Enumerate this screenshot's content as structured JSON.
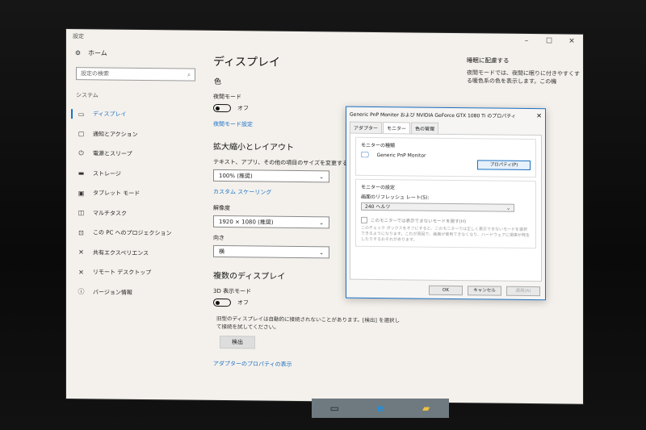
{
  "window": {
    "title": "設定"
  },
  "sidebar": {
    "home": "ホーム",
    "search_placeholder": "設定の検索",
    "section": "システム",
    "items": [
      {
        "label": "ディスプレイ",
        "icon": "monitor-icon",
        "active": true
      },
      {
        "label": "通知とアクション",
        "icon": "notification-icon"
      },
      {
        "label": "電源とスリープ",
        "icon": "power-icon"
      },
      {
        "label": "ストレージ",
        "icon": "storage-icon"
      },
      {
        "label": "タブレット モード",
        "icon": "tablet-icon"
      },
      {
        "label": "マルチタスク",
        "icon": "multitask-icon"
      },
      {
        "label": "この PC へのプロジェクション",
        "icon": "projection-icon"
      },
      {
        "label": "共有エクスペリエンス",
        "icon": "share-icon"
      },
      {
        "label": "リモート デスクトップ",
        "icon": "remote-icon"
      },
      {
        "label": "バージョン情報",
        "icon": "info-icon"
      }
    ]
  },
  "main": {
    "title": "ディスプレイ",
    "color_heading": "色",
    "night_mode_label": "夜間モード",
    "night_mode_state": "オフ",
    "night_mode_link": "夜間モード設定",
    "scale_heading": "拡大縮小とレイアウト",
    "scale_label": "テキスト、アプリ、その他の項目のサイズを変更する",
    "scale_value": "100% (推奨)",
    "custom_scaling_link": "カスタム スケーリング",
    "resolution_label": "解像度",
    "resolution_value": "1920 × 1080 (推奨)",
    "orientation_label": "向き",
    "orientation_value": "横",
    "multi_heading": "複数のディスプレイ",
    "3d_label": "3D 表示モード",
    "3d_state": "オフ",
    "detect_desc": "旧型のディスプレイは自動的に接続されないことがあります。[検出] を選択して接続を試してください。",
    "detect_button": "検出",
    "adapter_link": "アダプターのプロパティの表示"
  },
  "right": {
    "title": "睡眠に配慮する",
    "desc": "夜間モードでは、夜間に眠りに付きやすくする暖色系の色を表示します。この機"
  },
  "dialog": {
    "title": "Generic PnP Monitor および NVIDIA GeForce GTX 1080 Ti のプロパティ",
    "tabs": [
      "アダプター",
      "モニター",
      "色の管理"
    ],
    "type_group": "モニターの種類",
    "monitor_name": "Generic PnP Monitor",
    "properties_button": "プロパティ(P)",
    "settings_group": "モニターの設定",
    "refresh_label": "画面のリフレッシュ レート(S):",
    "refresh_value": "240 ヘルツ",
    "hide_modes": "このモニターでは表示できないモードを隠す(H)",
    "hint": "このチェック ボックスをオフにすると、このモニターでは正しく表示できないモードを選択できるようになります。これが原因で、画面が使用できなくなり、ハードウェアに損害が発生したりするおそれがあります。",
    "ok": "OK",
    "cancel": "キャンセル",
    "apply": "適用(A)"
  },
  "colors": {
    "accent": "#1a6fc4",
    "screen_bg": "#f4f1ec"
  }
}
